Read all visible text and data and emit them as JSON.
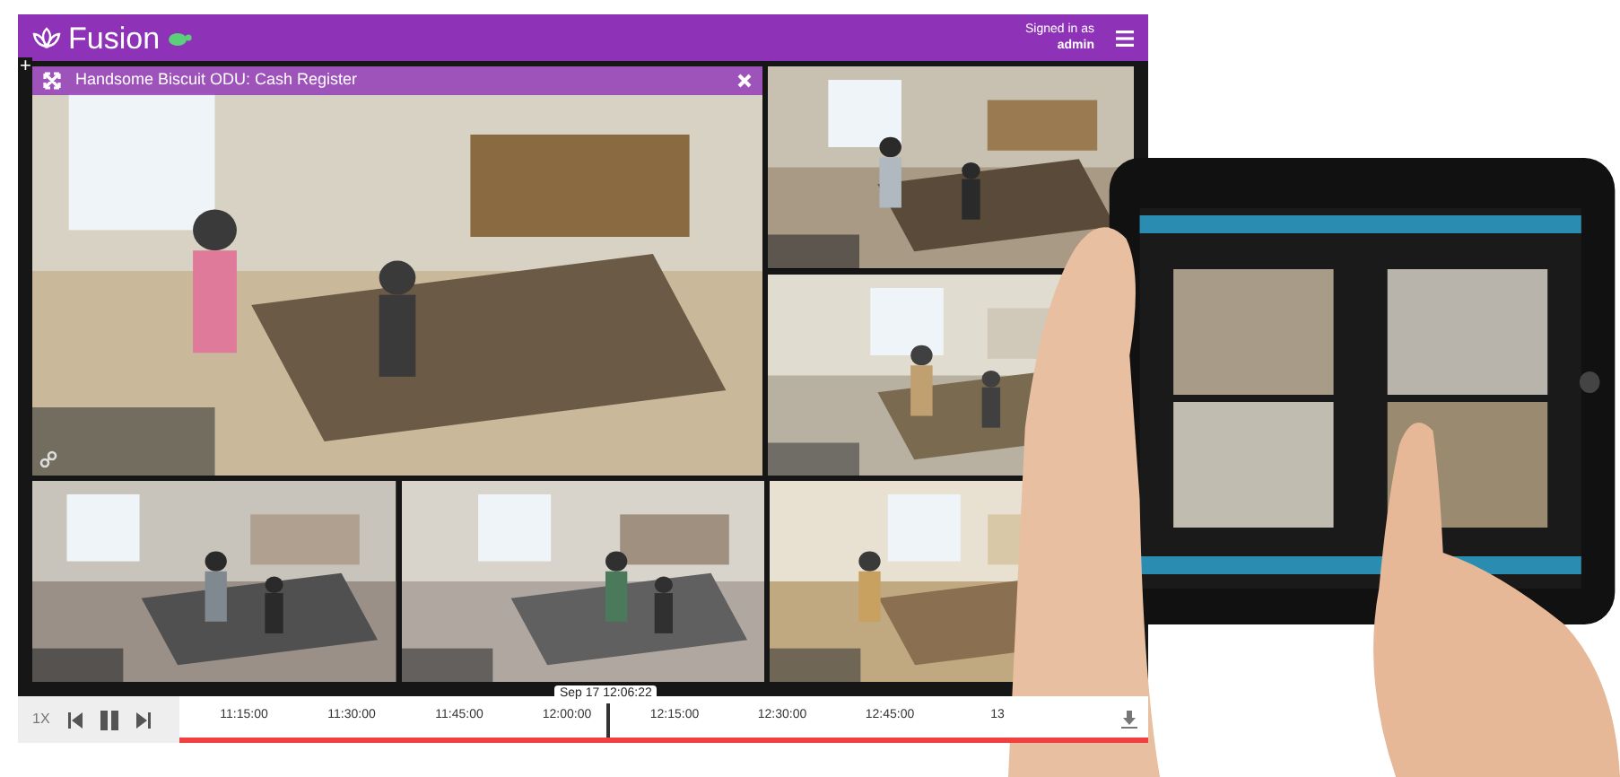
{
  "header": {
    "logo": "Fusion",
    "signed_in_label": "Signed in as",
    "user": "admin"
  },
  "add_symbol": "+",
  "tiles": [
    {
      "kind": "picture",
      "title": "Handsome Biscuit ODU: Cash Register"
    },
    {
      "kind": "picture"
    },
    {
      "kind": "picture"
    },
    {
      "kind": "picture"
    },
    {
      "kind": "picture"
    },
    {
      "kind": "picture"
    }
  ],
  "timeline": {
    "speed": "1X",
    "cursor_time": "Sep 17 12:06:22",
    "ticks": [
      "11:15:00",
      "11:30:00",
      "11:45:00",
      "12:00:00",
      "12:15:00",
      "12:30:00",
      "12:45:00",
      "13"
    ]
  },
  "overlay": {
    "kind": "picture"
  }
}
